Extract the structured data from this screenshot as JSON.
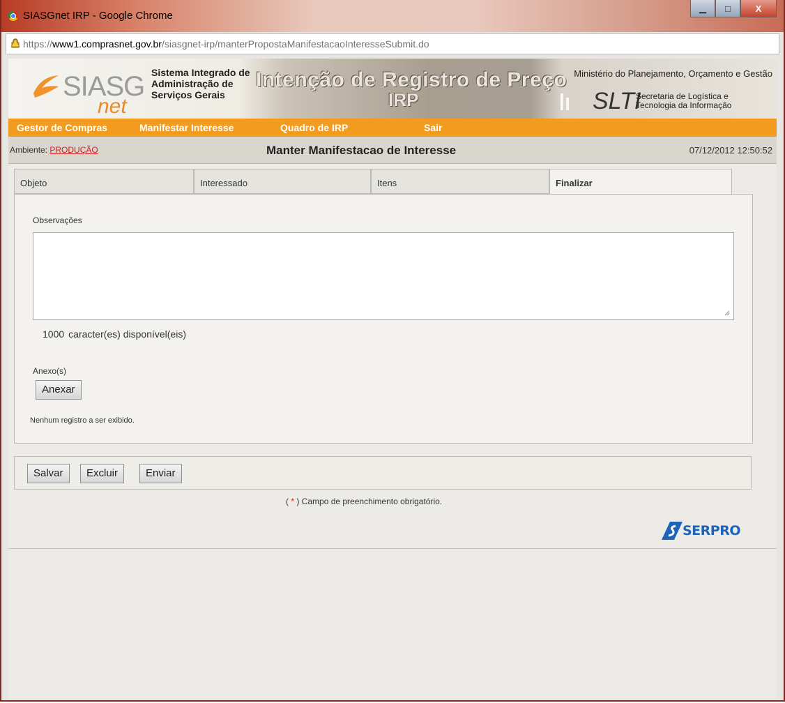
{
  "window": {
    "title": "SIASGnet IRP - Google Chrome",
    "url_prefix": "https://",
    "url_host": "www1.comprasnet.gov.br",
    "url_path": "/siasgnet-irp/manterPropostaManifestacaoInteresseSubmit.do",
    "btn_min": "▁",
    "btn_max": "□",
    "btn_close": "X"
  },
  "header": {
    "logo_siasg": "SIASG",
    "logo_net": "net",
    "sys_line1": "Sistema Integrado de",
    "sys_line2": "Administração de",
    "sys_line3": "Serviços Gerais",
    "irp_title": "Intenção de Registro de Preço",
    "irp_sub": "IRP",
    "ministry": "Ministério do Planejamento, Orçamento e Gestão",
    "slti_logo": "SLTI",
    "slti_line1": "Secretaria de Logística e",
    "slti_line2": "Tecnologia da Informação"
  },
  "menu": {
    "items": [
      "Gestor de Compras",
      "Manifestar Interesse",
      "Quadro de IRP",
      "Sair"
    ]
  },
  "env": {
    "label": "Ambiente: ",
    "value": "PRODUÇÃO",
    "page_title": "Manter Manifestacao de Interesse",
    "datetime": "07/12/2012 12:50:52"
  },
  "tabs": [
    "Objeto",
    "Interessado",
    "Itens",
    "Finalizar"
  ],
  "form": {
    "obs_label": "Observações",
    "obs_value": "",
    "char_count": "1000",
    "char_text": "caracter(es) disponível(eis)",
    "annex_label": "Anexo(s)",
    "annex_button": "Anexar",
    "empty_text": "Nenhum registro a ser exibido."
  },
  "actions": {
    "save": "Salvar",
    "delete": "Excluir",
    "send": "Enviar"
  },
  "footer": {
    "req_open": "( ",
    "req_star": "*",
    "req_close": " ) Campo de preenchimento obrigatório.",
    "serpro": "SERPRO"
  },
  "colors": {
    "menu_orange": "#f29b1f",
    "link_red": "#d02020",
    "serpro_blue": "#1d63b8"
  }
}
